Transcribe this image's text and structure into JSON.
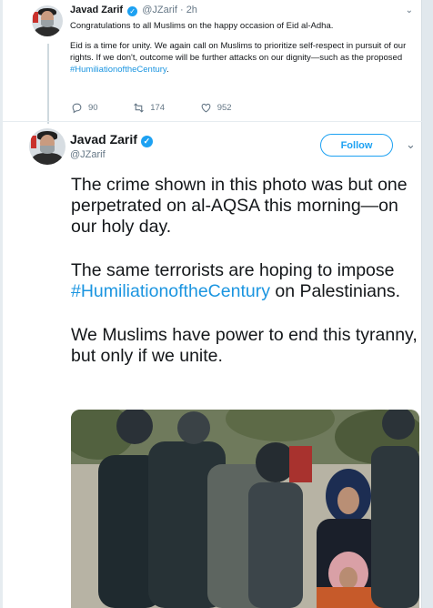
{
  "reply": {
    "name": "Javad Zarif",
    "handle": "@JZarif",
    "time": "2h",
    "paragraph1": "Congratulations to all Muslims on the happy occasion of Eid al-Adha.",
    "paragraph2_text": "Eid is a time for unity. We again call on Muslims to prioritize self-respect in pursuit of our rights. If we don't, outcome will be further attacks on our dignity—such as the proposed ",
    "paragraph2_hashtag": "#HumiliationoftheCentury",
    "paragraph2_end": ".",
    "replies_count": "90",
    "retweets_count": "174",
    "likes_count": "952"
  },
  "main": {
    "name": "Javad Zarif",
    "handle": "@JZarif",
    "follow_label": "Follow",
    "line1": "The crime shown in this photo was but one perpetrated on al-AQSA this morning—on our holy day.",
    "line2_text": "The same terrorists are hoping to impose ",
    "line2_hashtag": "#HumiliationoftheCentury",
    "line2_end": " on Palestinians.",
    "line3": "We Muslims have power to end this tyranny, but only if we unite."
  },
  "colors": {
    "accent": "#1da1f2",
    "hashtag": "#1b95e0",
    "meta": "#657786"
  },
  "icons": [
    "verified-badge-icon",
    "reply-icon",
    "retweet-icon",
    "like-icon",
    "chevron-down-icon"
  ]
}
